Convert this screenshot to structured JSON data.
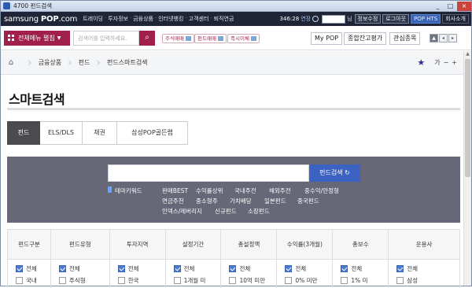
{
  "window": {
    "title": "4700 펀드검색",
    "controls": [
      "_",
      "□",
      "×"
    ]
  },
  "topbar": {
    "logo_prefix": "samsung ",
    "logo_brand": "POP",
    "logo_suffix": ".com",
    "menu": [
      "트레이딩",
      "투자정보",
      "금융상품",
      "인터넷뱅킹",
      "고객센터",
      "퇴직연금"
    ],
    "timer": "346:28",
    "extend": "연장",
    "name_suffix": "님",
    "buttons": [
      "정보수정",
      "로그아웃"
    ],
    "hts": "POP HTS",
    "intro": "회사소개"
  },
  "search": {
    "all_menu": "전체메뉴 펼침",
    "placeholder": "검색어를 입력하세요.",
    "quick": [
      "주식매매",
      "펀드매매",
      "즉시이체"
    ],
    "my_pop": "My POP",
    "balance": "종합잔고평가",
    "watch": "관심종목"
  },
  "breadcrumb": {
    "items": [
      "금융상품",
      "펀드",
      "펀드스마트검색"
    ],
    "font_label": "가",
    "minus": "−",
    "plus": "+"
  },
  "page": {
    "title": "스마트검색"
  },
  "tabs": [
    "펀드",
    "ELS/DLS",
    "채권",
    "삼성POP골든랩"
  ],
  "panel": {
    "button": "펀드검색",
    "theme_keyword": "테마키워드",
    "keywords_row1": [
      "판매BEST",
      "수익률상위",
      "국내주전",
      "해외주전",
      "중수익/안정형"
    ],
    "keywords_row2": [
      "연금주천",
      "중소형주",
      "가치배당",
      "일본펀드",
      "중국펀드"
    ],
    "keywords_row3": [
      "인덱스/레버리지",
      "신규펀드",
      "소장펀드"
    ]
  },
  "filters": {
    "headers": [
      "펀드구분",
      "펀드유형",
      "투자지역",
      "설정기간",
      "총설정액",
      "수익률(3개월)",
      "총보수",
      "운용사"
    ],
    "all_label": "전체",
    "second_options": [
      "국내",
      "주식형",
      "한국",
      "1개월 미",
      "10억 미만",
      "0% 미만",
      "1% 미",
      "삼성"
    ]
  },
  "colors": {
    "navy": "#1f2536",
    "brand": "#a01f4c",
    "panel": "#666777",
    "search_button": "#3c63c1"
  }
}
